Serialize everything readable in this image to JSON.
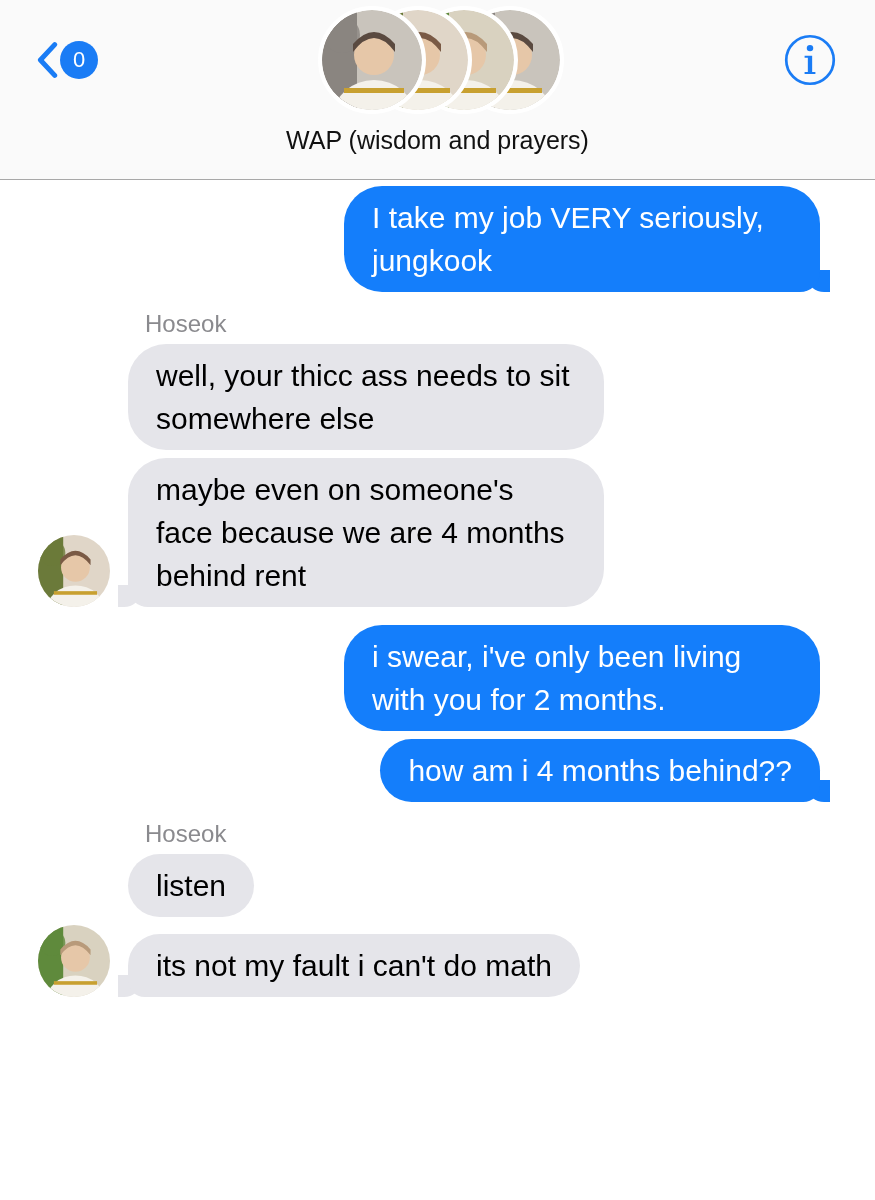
{
  "header": {
    "back_badge": "0",
    "title": "WAP (wisdom and prayers)"
  },
  "groups": [
    {
      "kind": "outgoing",
      "messages": [
        "I take my job VERY seriously, jungkook"
      ]
    },
    {
      "kind": "incoming",
      "sender": "Hoseok",
      "messages": [
        "well, your thicc ass needs to sit somewhere else",
        "maybe even on someone's face because we are 4 months behind rent"
      ]
    },
    {
      "kind": "outgoing",
      "messages": [
        "i swear, i've only been living with you for 2 months.",
        "how am i 4 months behind??"
      ]
    },
    {
      "kind": "incoming",
      "sender": "Hoseok",
      "messages": [
        "listen",
        "its not my fault i can't do math"
      ]
    }
  ]
}
